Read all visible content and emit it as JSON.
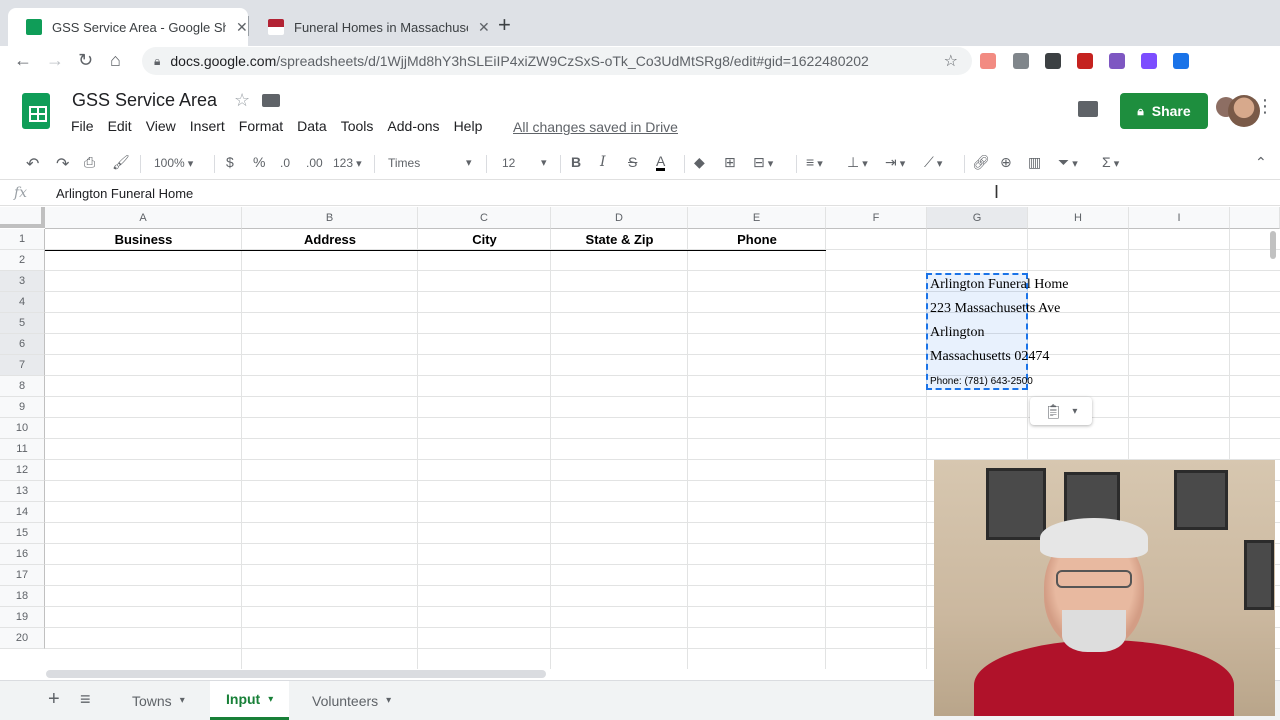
{
  "browser": {
    "tabs": [
      {
        "title": "GSS Service Area - Google Sheets",
        "favicon": "sheets-icon",
        "active": true
      },
      {
        "title": "Funeral Homes in Massachusetts",
        "favicon": "us-flag-icon",
        "active": false
      }
    ],
    "url_host": "docs.google.com",
    "url_path": "/spreadsheets/d/1WjjMd8hY3hSLEiIP4xiZW9CzSxS-oTk_Co3UdMtSRg8/edit#gid=1622480202"
  },
  "doc": {
    "title": "GSS Service Area",
    "menu": [
      "File",
      "Edit",
      "View",
      "Insert",
      "Format",
      "Data",
      "Tools",
      "Add-ons",
      "Help"
    ],
    "save_status": "All changes saved in Drive",
    "share_label": "Share"
  },
  "toolbar": {
    "zoom": "100%",
    "currency": "$",
    "percent": "%",
    "dec_less": ".0",
    "dec_more": ".00",
    "more_formats": "123",
    "font": "Times",
    "font_size": "12",
    "bold": "B",
    "italic": "I",
    "strike": "S",
    "text_color": "A",
    "sigma": "Σ"
  },
  "formula_bar": {
    "fx": "fx",
    "value": "Arlington Funeral Home"
  },
  "grid": {
    "columns": [
      "A",
      "B",
      "C",
      "D",
      "E",
      "F",
      "G",
      "H",
      "I"
    ],
    "rows": [
      "1",
      "2",
      "3",
      "4",
      "5",
      "6",
      "7",
      "8",
      "9",
      "10",
      "11",
      "12",
      "13",
      "14",
      "15",
      "16",
      "17",
      "18",
      "19",
      "20"
    ],
    "header_row": [
      "Business",
      "Address",
      "City",
      "State & Zip",
      "Phone"
    ],
    "pasted": {
      "line1": "Arlington Funeral Home",
      "line2": "223 Massachusetts Ave",
      "line3": "Arlington",
      "line4": "Massachusetts 02474",
      "line5": "Phone: (781) 643-2500"
    }
  },
  "sheets": [
    {
      "name": "Towns",
      "active": false
    },
    {
      "name": "Input",
      "active": true
    },
    {
      "name": "Volunteers",
      "active": false
    }
  ],
  "colors": {
    "accent": "#1a73e8",
    "share": "#1e8e3e",
    "active_sheet": "#188038"
  }
}
